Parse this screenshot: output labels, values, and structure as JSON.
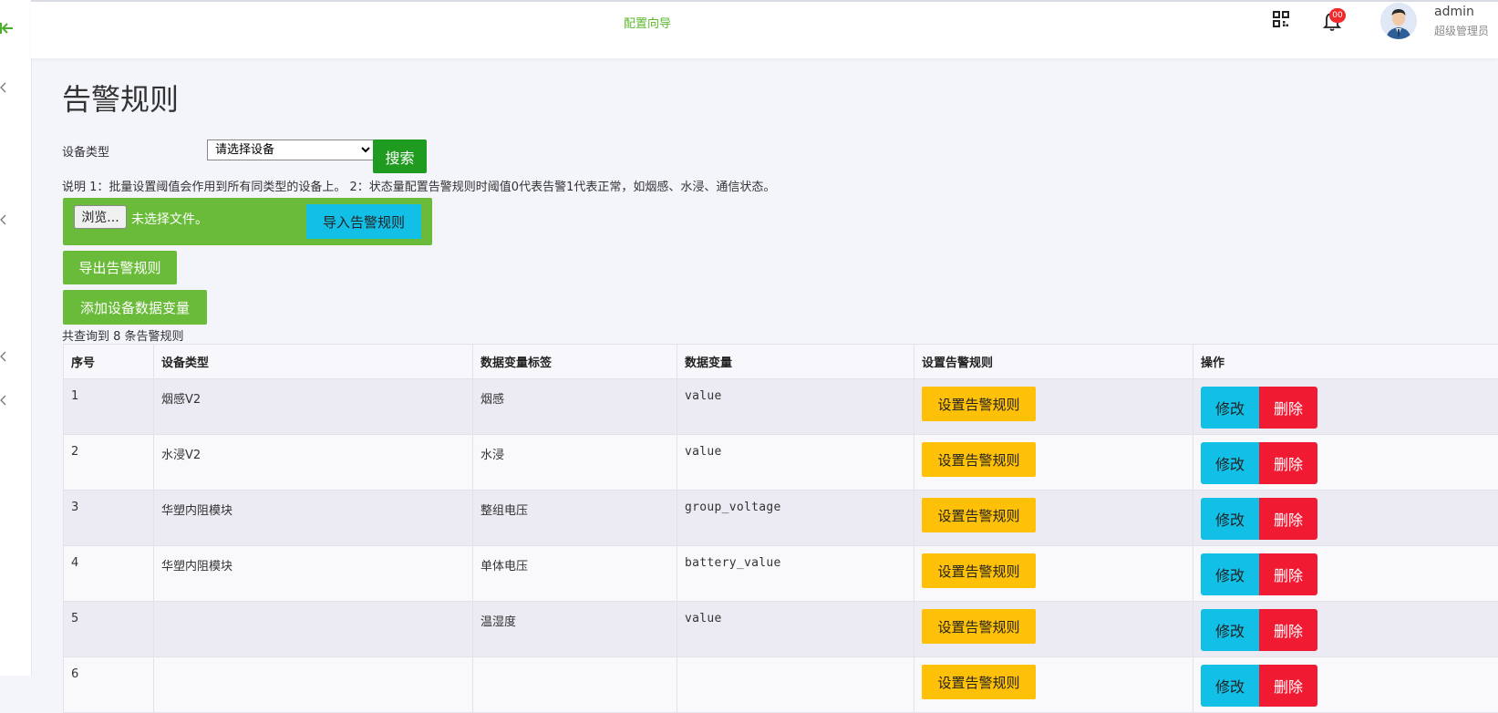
{
  "topbar": {
    "wizard_link": "配置向导",
    "notification_badge": "00",
    "user_name": "admin",
    "user_role": "超级管理员"
  },
  "page": {
    "title": "告警规则",
    "filter_label": "设备类型",
    "select_value": "请选择设备",
    "search_button": "搜索",
    "note": "说明 1：批量设置阈值会作用到所有同类型的设备上。 2：状态量配置告警规则时阈值0代表告警1代表正常，如烟感、水浸、通信状态。",
    "browse_button": "浏览...",
    "no_file_text": "未选择文件。",
    "import_button": "导入告警规则",
    "export_button": "导出告警规则",
    "add_button": "添加设备数据变量",
    "count_text": "共查询到 8 条告警规则"
  },
  "table": {
    "headers": [
      "序号",
      "设备类型",
      "数据变量标签",
      "数据变量",
      "设置告警规则",
      "操作"
    ],
    "rule_button": "设置告警规则",
    "edit_button": "修改",
    "delete_button": "删除",
    "rows": [
      {
        "no": "1",
        "device_type": "烟感V2",
        "label": "烟感",
        "variable": "value"
      },
      {
        "no": "2",
        "device_type": "水浸V2",
        "label": "水浸",
        "variable": "value"
      },
      {
        "no": "3",
        "device_type": "华塑内阻模块",
        "label": "整组电压",
        "variable": "group_voltage"
      },
      {
        "no": "4",
        "device_type": "华塑内阻模块",
        "label": "单体电压",
        "variable": "battery_value"
      },
      {
        "no": "5",
        "device_type": "",
        "label": "温湿度",
        "variable": "value"
      },
      {
        "no": "6",
        "device_type": "",
        "label": "",
        "variable": ""
      }
    ]
  },
  "colors": {
    "green": "#6abb39",
    "dark_green": "#1f9b1f",
    "cyan": "#12bfe6",
    "yellow": "#ffc107",
    "red": "#f01b33"
  },
  "icons": [
    "collapse-sidebar-icon",
    "chevron-left-icon",
    "grid-icon",
    "bell-icon"
  ]
}
